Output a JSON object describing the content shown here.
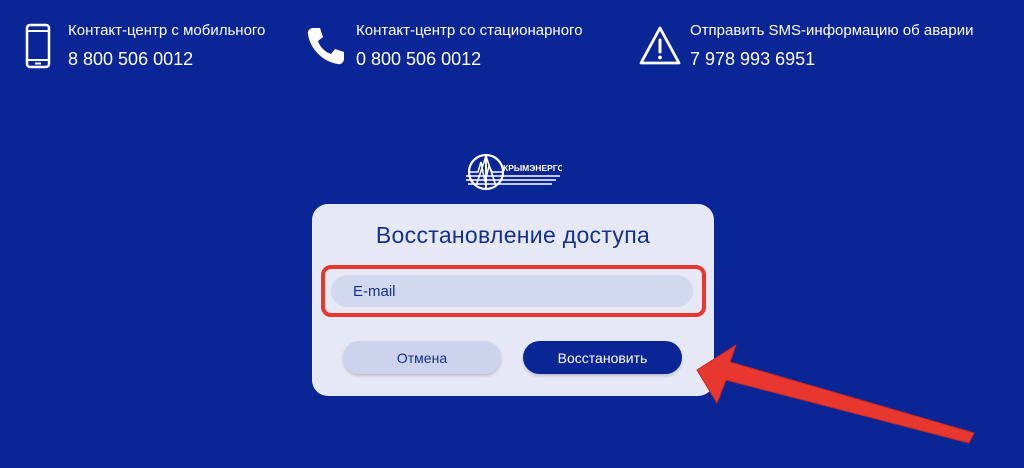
{
  "header": {
    "contacts": [
      {
        "label": "Контакт-центр с мобильного",
        "value": "8 800 506 0012",
        "icon": "mobile-phone-icon"
      },
      {
        "label": "Контакт-центр со стационарного",
        "value": "0 800 506 0012",
        "icon": "phone-handset-icon"
      },
      {
        "label": "Отправить SMS-информацию об аварии",
        "value": "7 978 993 6951",
        "icon": "warning-triangle-icon"
      }
    ]
  },
  "logo": {
    "text": "КРЫМЭНЕРГО"
  },
  "card": {
    "title": "Восстановление доступа",
    "email_placeholder": "E-mail",
    "email_value": "",
    "cancel_label": "Отмена",
    "restore_label": "Восстановить"
  },
  "colors": {
    "background": "#0a2596",
    "card": "#e6e9f5",
    "accent_text": "#13308f",
    "highlight": "#e8372f"
  }
}
